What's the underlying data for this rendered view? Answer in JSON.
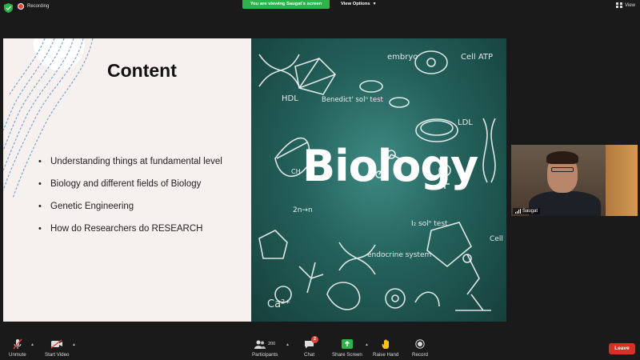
{
  "top_bar": {
    "recording_label": "Recording",
    "viewing_banner": "You are viewing Saugat's screen",
    "view_options_label": "View Options",
    "view_label": "View"
  },
  "slide": {
    "title": "Content",
    "bullets": [
      "Understanding things at fundamental level",
      "Biology and different fields of Biology",
      "Genetic Engineering",
      "How do Researchers do RESEARCH"
    ],
    "image": {
      "headline": "Biology",
      "words": {
        "embryo": "embryo",
        "cell_atp": "Cell ATP",
        "hdl": "HDL",
        "benedict": "Benedict' solⁿ test",
        "ldl": "LDL",
        "ch": "CH",
        "zn": "2n→n",
        "iodine": "I₂ solⁿ test",
        "endocrine": "endocrine system",
        "cell": "Cell",
        "calcium": "Ca²⁺"
      }
    }
  },
  "participant": {
    "name": "Saugat"
  },
  "toolbar": {
    "unmute_label": "Unmute",
    "start_video_label": "Start Video",
    "participants_label": "Participants",
    "participants_count": "200",
    "chat_label": "Chat",
    "chat_badge": "2",
    "share_screen_label": "Share Screen",
    "raise_hand_label": "Raise Hand",
    "record_label": "Record",
    "leave_label": "Leave"
  },
  "colors": {
    "share_green": "#2db34a",
    "leave_red": "#d93025",
    "chalkboard": "#2f6f69"
  }
}
